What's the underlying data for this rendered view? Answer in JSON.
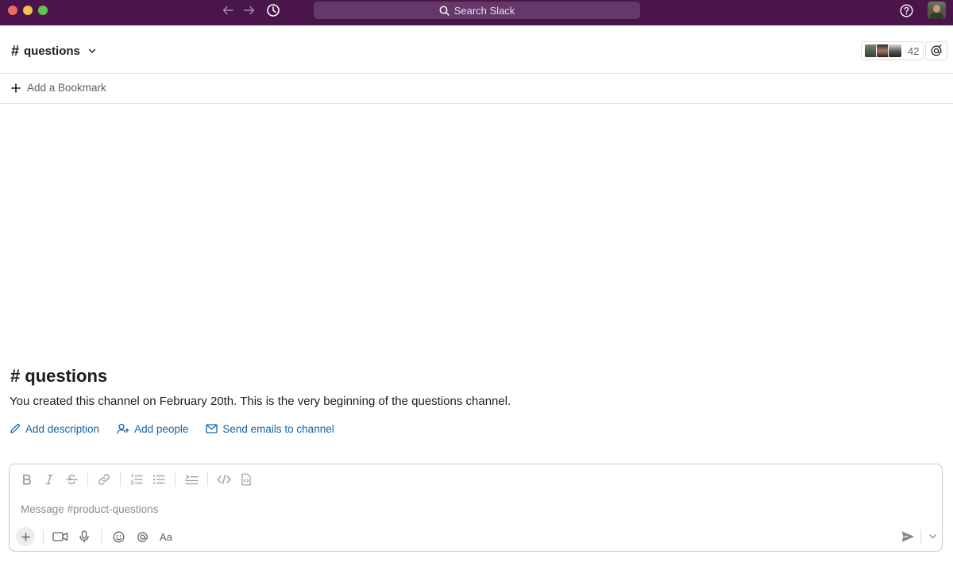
{
  "titlebar": {
    "search_placeholder": "Search Slack",
    "icons": [
      "arrow-left-icon",
      "arrow-right-icon",
      "history-icon",
      "search-icon",
      "help-icon"
    ],
    "bg_color": "#4a154b"
  },
  "header": {
    "channel_hash": "#",
    "channel_name": "questions",
    "member_count": "42"
  },
  "bookmarks": {
    "add_label": "Add a Bookmark"
  },
  "intro": {
    "hash": "#",
    "title": "questions",
    "description": "You created this channel on February 20th. This is the very beginning of the questions channel.",
    "actions": {
      "add_description": "Add description",
      "add_people": "Add people",
      "send_emails": "Send emails to channel"
    },
    "link_color": "#1264a3"
  },
  "composer": {
    "placeholder": "Message #product-questions",
    "format_label": "Aa",
    "formatting": [
      "bold",
      "italic",
      "strikethrough",
      "link",
      "ordered-list",
      "bulleted-list",
      "blockquote",
      "code",
      "code-block"
    ],
    "bottom_actions": [
      "attach",
      "video-clip",
      "audio-clip",
      "emoji",
      "mention",
      "formatting"
    ]
  }
}
